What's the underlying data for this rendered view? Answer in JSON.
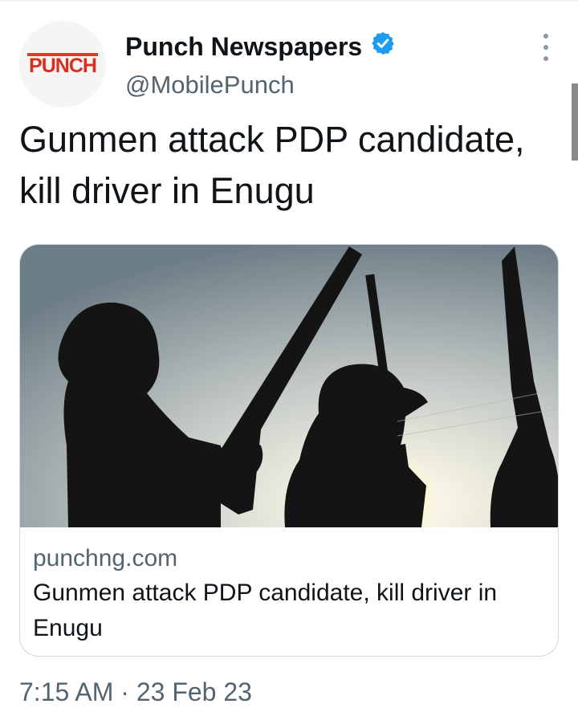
{
  "tweet": {
    "author_name": "Punch Newspapers",
    "handle": "@MobilePunch",
    "avatar_text": "PUNCH",
    "verified_icon": "verified-badge-icon",
    "menu_icon": "more-vertical-icon",
    "text": "Gunmen attack PDP candidate, kill driver in Enugu",
    "timestamp": "7:15 AM · 23 Feb 23"
  },
  "link_card": {
    "domain": "punchng.com",
    "title": "Gunmen attack PDP candidate, kill driver in Enugu",
    "image_icon": "armed-men-silhouette-photo"
  },
  "colors": {
    "verified_blue": "#1d9bf0",
    "secondary_text": "#536471",
    "brand_red": "#d92d20",
    "border": "#cfd9de"
  }
}
